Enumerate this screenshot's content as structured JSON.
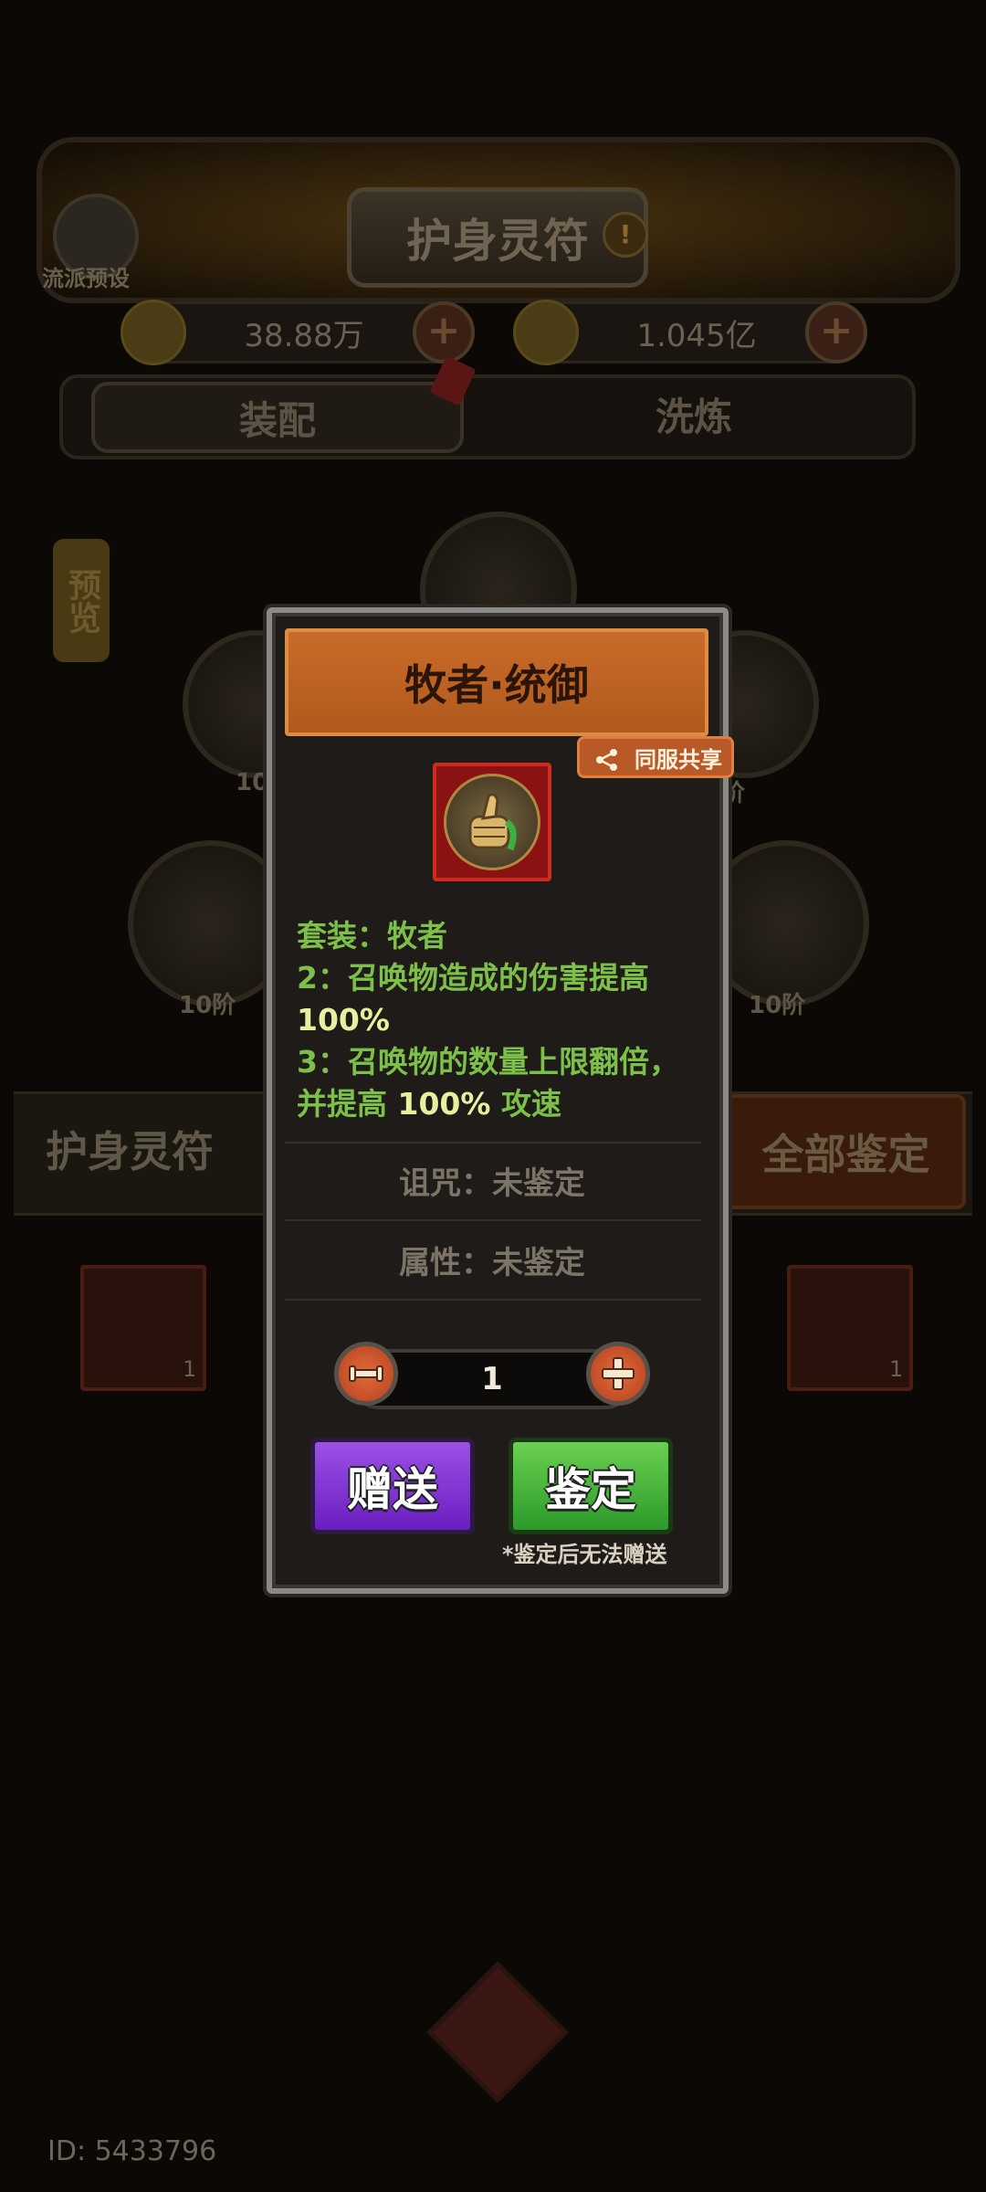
{
  "header": {
    "title": "护身灵符",
    "info_glyph": "!",
    "preset_label": "流派预设"
  },
  "currencies": [
    {
      "icon": "ghost-coin-icon",
      "value": "38.88万"
    },
    {
      "icon": "gold-coin-icon",
      "value": "1.045亿"
    }
  ],
  "tabs": [
    {
      "label": "装配",
      "active": true
    },
    {
      "label": "洗炼",
      "active": false
    }
  ],
  "preview_label": "预览",
  "slots": [
    {
      "label": "10"
    },
    {
      "label": "阶"
    },
    {
      "label": "10阶"
    },
    {
      "label": "10阶"
    }
  ],
  "inventory": {
    "section_title": "护身灵符",
    "all_identify_label": "全部鉴定",
    "counts": [
      "1",
      "1"
    ]
  },
  "popup": {
    "title": "牧者·统御",
    "share_label": "同服共享",
    "item_icon": "thumbs-up-icon",
    "set_line": "套装：牧者",
    "bonus_2_line1": "2：召唤物造成的伤害提高",
    "bonus_2_line2": "100%",
    "bonus_3_line1": "3：召唤物的数量上限翻倍，",
    "bonus_3_prefix": "并提高 ",
    "bonus_3_value": "100%",
    "bonus_3_suffix": " 攻速",
    "curse_line": "诅咒：未鉴定",
    "attr_line": "属性：未鉴定",
    "quantity": "1",
    "gift_label": "赠送",
    "identify_label": "鉴定",
    "note": "*鉴定后无法赠送"
  },
  "footer": {
    "player_id": "ID: 5433796"
  },
  "colors": {
    "accent_orange": "#c96b2a",
    "set_green": "#7cc04a",
    "highlight_yellow": "#e8f0a0",
    "gift_purple": "#7a2ed0",
    "identify_green": "#3aa830"
  }
}
